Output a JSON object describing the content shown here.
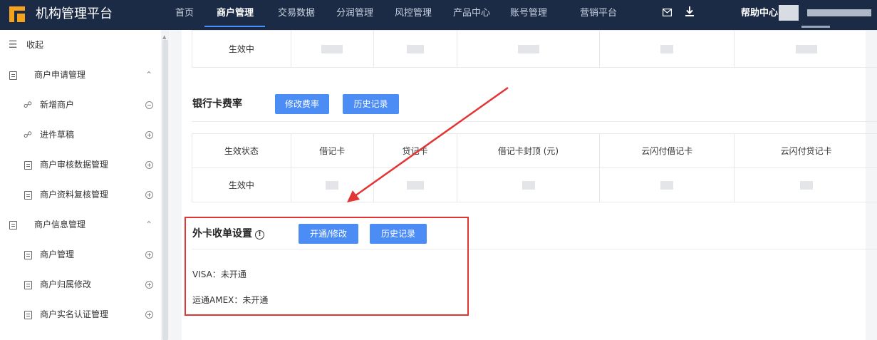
{
  "app": {
    "title": "机构管理平台"
  },
  "topnav": {
    "items": [
      {
        "label": "首页"
      },
      {
        "label": "商户管理",
        "active": true
      },
      {
        "label": "交易数据"
      },
      {
        "label": "分润管理"
      },
      {
        "label": "风控管理"
      },
      {
        "label": "产品中心"
      },
      {
        "label": "账号管理"
      },
      {
        "label": "营销平台"
      }
    ],
    "icons": [
      "mail-icon",
      "download-icon"
    ],
    "help": "帮助中心"
  },
  "sidebar": {
    "collapse_label": "收起",
    "items": [
      {
        "label": "商户申请管理",
        "level": 1,
        "icon": "document-icon",
        "control": "chevron-up"
      },
      {
        "label": "新增商户",
        "level": 2,
        "icon": "org-tree-icon",
        "control": "minus"
      },
      {
        "label": "进件草稿",
        "level": 2,
        "icon": "org-tree-icon",
        "control": "plus"
      },
      {
        "label": "商户审核数据管理",
        "level": 2,
        "icon": "checklist-icon",
        "control": "plus"
      },
      {
        "label": "商户资料复核管理",
        "level": 2,
        "icon": "checklist-icon",
        "control": "plus"
      },
      {
        "label": "商户信息管理",
        "level": 1,
        "icon": "document-icon",
        "control": "chevron-up"
      },
      {
        "label": "商户管理",
        "level": 2,
        "icon": "store-icon",
        "control": "plus"
      },
      {
        "label": "商户归属修改",
        "level": 2,
        "icon": "store-icon",
        "control": "plus"
      },
      {
        "label": "商户实名认证管理",
        "level": 2,
        "icon": "id-card-icon",
        "control": "plus"
      }
    ]
  },
  "top_table": {
    "status": "生效中"
  },
  "bank_card_rate": {
    "title": "银行卡费率",
    "modify_button": "修改费率",
    "history_button": "历史记录",
    "headers": [
      "生效状态",
      "借记卡",
      "贷记卡",
      "借记卡封顶 (元)",
      "云闪付借记卡",
      "云闪付贷记卡"
    ],
    "row": {
      "status": "生效中"
    }
  },
  "foreign_card": {
    "title": "外卡收单设置",
    "open_button": "开通/修改",
    "history_button": "历史记录",
    "visa_label": "VISA：",
    "visa_value": "未开通",
    "amex_label": "运通AMEX：",
    "amex_value": "未开通"
  },
  "colors": {
    "nav_bg": "#1b2a45",
    "primary": "#4b8cf5",
    "highlight_red": "#e43535",
    "logo": "#f7a21b"
  }
}
